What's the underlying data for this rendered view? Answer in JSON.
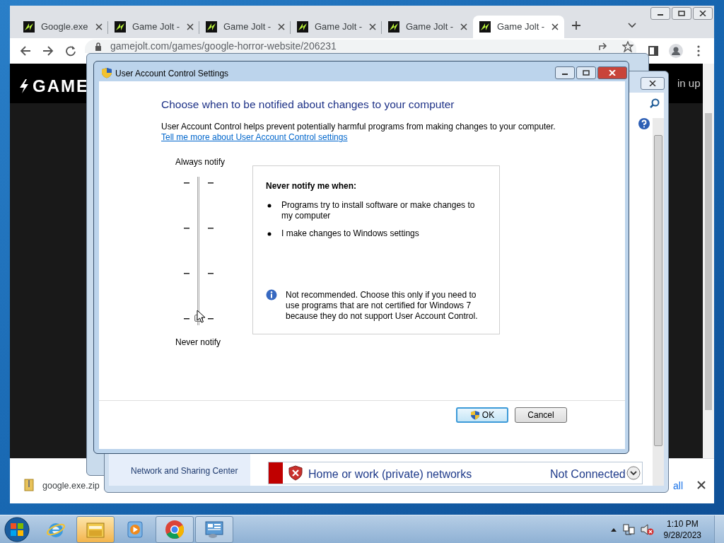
{
  "browser": {
    "tabs": [
      {
        "label": "Google.exe",
        "selected": false
      },
      {
        "label": "Game Jolt -",
        "selected": false
      },
      {
        "label": "Game Jolt -",
        "selected": false
      },
      {
        "label": "Game Jolt -",
        "selected": false
      },
      {
        "label": "Game Jolt -",
        "selected": false
      },
      {
        "label": "Game Jolt -",
        "selected": true
      }
    ],
    "url": "gamejolt.com/games/google-horror-website/206231",
    "page": {
      "logo": "GAME",
      "header_link": "in up"
    },
    "download": {
      "file": "google.exe.zip",
      "show_all": "all"
    }
  },
  "control_panel": {
    "left_item": "Network and Sharing Center",
    "network": {
      "name": "Home or work (private) networks",
      "status": "Not Connected"
    }
  },
  "dialog": {
    "title": "User Account Control Settings",
    "heading": "Choose when to be notified about changes to your computer",
    "description": "User Account Control helps prevent potentially harmful programs from making changes to your computer.",
    "link": "Tell me more about User Account Control settings",
    "slider": {
      "top_label": "Always notify",
      "bottom_label": "Never notify",
      "level": 0
    },
    "info": {
      "heading": "Never notify me when:",
      "bullets": [
        "Programs try to install software or make changes to my computer",
        "I make changes to Windows settings"
      ],
      "note": "Not recommended. Choose this only if you need to use programs that are not certified for Windows 7 because they do not support User Account Control."
    },
    "buttons": [
      {
        "label": "OK",
        "default": true
      },
      {
        "label": "Cancel",
        "default": false
      }
    ]
  },
  "taskbar": {
    "apps": [
      {
        "kind": "ie",
        "selected": false,
        "running": false
      },
      {
        "kind": "explorer",
        "selected": true,
        "running": true
      },
      {
        "kind": "media",
        "selected": false,
        "running": false
      },
      {
        "kind": "chrome",
        "selected": false,
        "running": true
      },
      {
        "kind": "control",
        "selected": false,
        "running": true
      }
    ],
    "time": "1:10 PM",
    "date": "9/28/2023"
  }
}
